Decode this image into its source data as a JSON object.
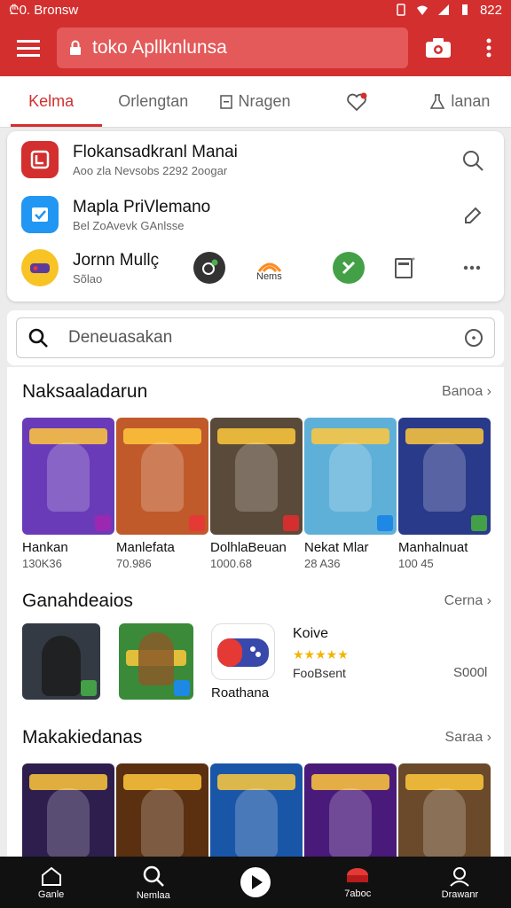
{
  "status": {
    "left": "₾0. Bronsw",
    "right": "822"
  },
  "appbar": {
    "url": "toko Apllknlunsa",
    "accent": "#d32f2f"
  },
  "tabs": [
    "Kelma",
    "Orlengtan",
    "Nragen",
    "",
    "lanan"
  ],
  "rows": [
    {
      "title": "Flokansadkranl Manai",
      "sub": "Aoo zla Nevsobs 2292 2oogar"
    },
    {
      "title": "Mapla PriVlemano",
      "sub": "Bel ZoAvevk GAnlsse"
    },
    {
      "title": "Jornn Mullç",
      "sub": "Sõlao"
    }
  ],
  "quick_actions": [
    {
      "label": ""
    },
    {
      "label": "Nems"
    },
    {
      "label": ""
    },
    {
      "label": ""
    }
  ],
  "search": {
    "placeholder": "Deneuasakan"
  },
  "sections": [
    {
      "title": "Naksaaladarun",
      "more": "Banoa"
    },
    {
      "title": "Ganahdeaios",
      "more": "Cerna"
    },
    {
      "title": "Makakiedanas",
      "more": "Saraa"
    }
  ],
  "games1": [
    {
      "name": "Hankan",
      "meta": "130K36",
      "color": "#6a3bb8"
    },
    {
      "name": "Manlefata",
      "meta": "70.986",
      "color": "#c05a2a"
    },
    {
      "name": "DolhlaBeuan",
      "meta": "1000.68",
      "color": "#5a4a3a"
    },
    {
      "name": "Nekat Mlar",
      "meta": "28 A36",
      "color": "#5fb0d8"
    },
    {
      "name": "Manhalnuat",
      "meta": "100 45",
      "color": "#2a3a8a"
    }
  ],
  "games2": [
    {
      "color": "#333a44"
    },
    {
      "color": "#3a8a3a"
    },
    {
      "name": "Roathana",
      "color": "#ffffff"
    }
  ],
  "featured": {
    "name": "Koive",
    "dev": "FooBsent",
    "price": "S000l",
    "stars": "★★★★★"
  },
  "games3": [
    {
      "color": "#2e1e4e"
    },
    {
      "color": "#5a3010"
    },
    {
      "color": "#1a56a8"
    },
    {
      "color": "#4a1a7a"
    },
    {
      "color": "#6a4a2a"
    }
  ],
  "nav": [
    "Ganle",
    "Nemlaa",
    "",
    "7aboc",
    "Drawanr"
  ]
}
